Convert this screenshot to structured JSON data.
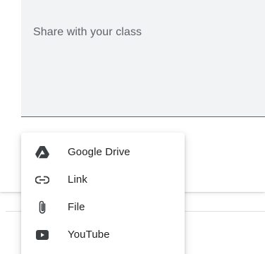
{
  "composer": {
    "placeholder": "Share with your class"
  },
  "add_menu": {
    "items": [
      {
        "label": "Google Drive",
        "icon": "google-drive-icon"
      },
      {
        "label": "Link",
        "icon": "link-icon"
      },
      {
        "label": "File",
        "icon": "paperclip-icon"
      },
      {
        "label": "YouTube",
        "icon": "youtube-icon"
      }
    ]
  },
  "colors": {
    "field_background": "#f1f3f4",
    "text_primary": "#202124",
    "text_secondary": "#5f6368",
    "icon": "#3c4043"
  }
}
